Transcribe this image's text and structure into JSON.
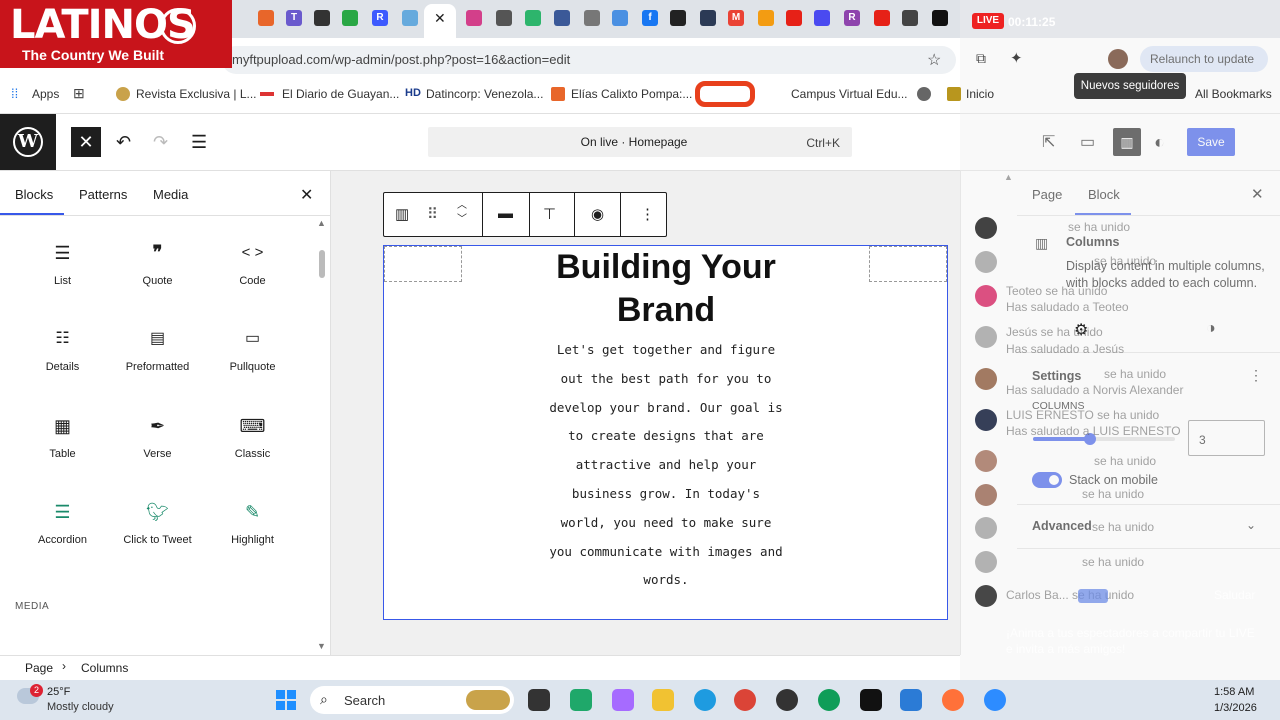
{
  "overlay_logo": {
    "brand": "LATINOS",
    "tagline": "The Country We Built"
  },
  "browser": {
    "url": "myftpupload.com/wp-admin/post.php?post=16&action=edit",
    "relaunch_label": "Relaunch to update",
    "bookmarks": [
      "Apps",
      "Revista Exclusiva | L...",
      "El Diario de Guayan...",
      "Datincorp: Venezola...",
      "Elías Calixto Pompa:...",
      "Campus Virtual Edu...",
      "Inicio",
      "All Bookmarks"
    ]
  },
  "editor": {
    "command_title": "On live · Homepage",
    "command_shortcut": "Ctrl+K",
    "save_label": "Save"
  },
  "inserter": {
    "tabs": [
      "Blocks",
      "Patterns",
      "Media"
    ],
    "blocks": [
      {
        "label": "List",
        "icon": "list-icon"
      },
      {
        "label": "Quote",
        "icon": "quote-icon"
      },
      {
        "label": "Code",
        "icon": "code-icon"
      },
      {
        "label": "Details",
        "icon": "details-icon"
      },
      {
        "label": "Preformatted",
        "icon": "preformatted-icon"
      },
      {
        "label": "Pullquote",
        "icon": "pullquote-icon"
      },
      {
        "label": "Table",
        "icon": "table-icon"
      },
      {
        "label": "Verse",
        "icon": "verse-icon"
      },
      {
        "label": "Classic",
        "icon": "classic-icon"
      },
      {
        "label": "Accordion",
        "icon": "accordion-icon"
      },
      {
        "label": "Click to Tweet",
        "icon": "twitter-icon"
      },
      {
        "label": "Highlight",
        "icon": "highlight-icon"
      }
    ],
    "section_media": "MEDIA"
  },
  "canvas": {
    "heading": "Building Your Brand",
    "paragraph": "Let's get together and figure out the best path for you to develop your brand. Our goal is to create designs that are attractive and help your business grow. In today's world, you need to make sure you communicate with images and words."
  },
  "sidebar": {
    "tabs": [
      "Page",
      "Block"
    ],
    "block_name": "Columns",
    "block_description": "Display content in multiple columns, with blocks added to each column.",
    "settings_label": "Settings",
    "columns_label": "COLUMNS",
    "columns_value": "3",
    "stack_label": "Stack on mobile",
    "advanced_label": "Advanced"
  },
  "breadcrumb": [
    "Page",
    "Columns"
  ],
  "stream_overlay": {
    "live_label": "LIVE",
    "timer": "00:11:25",
    "tooltip": "Nuevos seguidores",
    "chat": [
      "se ha unido",
      "se ha unido",
      "Teoteo se ha unido",
      "Has saludado a Teoteo",
      "Jesús se ha unido",
      "Has saludado a Jesús",
      "se ha unido",
      "Has saludado a Norvis Alexander",
      "LUIS ERNESTO se ha unido",
      "Has saludado a LUIS ERNESTO",
      "se ha unido",
      "se ha unido",
      "se ha unido",
      "se ha unido",
      "Carlos Ba... se ha unido",
      "Saludar",
      "¡Anima a tus espectadores a compartir tu LIVE e invita a más amigos!"
    ]
  },
  "taskbar": {
    "weather_temp": "25°F",
    "weather_desc": "Mostly cloudy",
    "weather_badge": "2",
    "search_label": "Search",
    "time": "1:58 AM",
    "date": "1/3/2026"
  }
}
